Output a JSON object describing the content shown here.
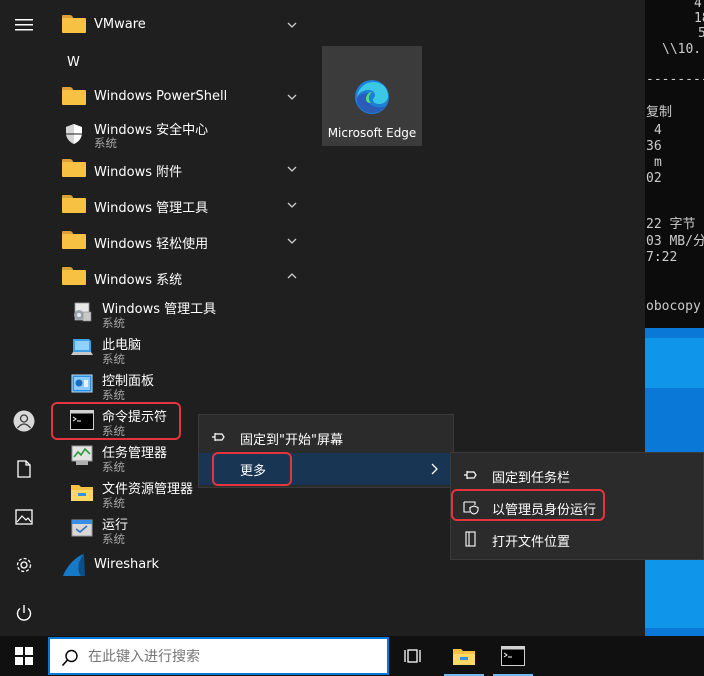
{
  "console_lines": [
    "4",
    "18",
    "5",
    "\\\\10.",
    "----------",
    "复制",
    "4",
    "36",
    "m",
    "02",
    "22 字节",
    "03 MB/分",
    "7:22",
    "obocopy"
  ],
  "start_menu": {
    "section_letter": "W",
    "apps": [
      {
        "label": "VMware",
        "type": "folder",
        "chevron": "down"
      },
      {
        "label": "Windows PowerShell",
        "type": "folder",
        "chevron": "down"
      },
      {
        "label": "Windows 安全中心",
        "sub": "系统",
        "type": "app"
      },
      {
        "label": "Windows 附件",
        "type": "folder",
        "chevron": "down"
      },
      {
        "label": "Windows 管理工具",
        "type": "folder",
        "chevron": "down"
      },
      {
        "label": "Windows 轻松使用",
        "type": "folder",
        "chevron": "down"
      },
      {
        "label": "Windows 系统",
        "type": "folder",
        "chevron": "up"
      },
      {
        "label": "Windows 管理工具",
        "sub": "系统",
        "type": "app"
      },
      {
        "label": "此电脑",
        "sub": "系统",
        "type": "app"
      },
      {
        "label": "控制面板",
        "sub": "系统",
        "type": "app"
      },
      {
        "label": "命令提示符",
        "sub": "系统",
        "type": "app"
      },
      {
        "label": "任务管理器",
        "sub": "系统",
        "type": "app"
      },
      {
        "label": "文件资源管理器",
        "sub": "系统",
        "type": "app"
      },
      {
        "label": "运行",
        "sub": "系统",
        "type": "app"
      },
      {
        "label": "Wireshark",
        "type": "app"
      }
    ],
    "tile": {
      "label": "Microsoft Edge"
    }
  },
  "context_menu": {
    "pin_start": "固定到\"开始\"屏幕",
    "more": "更多"
  },
  "submenu": {
    "pin_taskbar": "固定到任务栏",
    "run_as_admin": "以管理员身份运行",
    "open_location": "打开文件位置"
  },
  "taskbar": {
    "search_placeholder": "在此键入进行搜索"
  },
  "colors": {
    "highlight_box": "#e3343f",
    "menu_hover": "#193554",
    "search_border": "#0a78d7"
  }
}
